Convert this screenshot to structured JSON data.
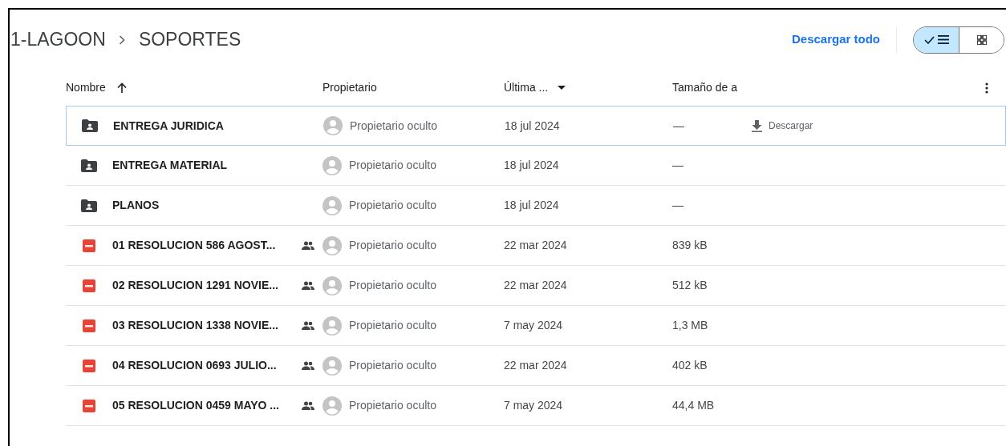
{
  "breadcrumb": [
    {
      "label": "1-LAGOON"
    },
    {
      "label": "SOPORTES"
    }
  ],
  "download_all": "Descargar todo",
  "view_toggle": [
    {
      "kind": "list",
      "selected": true
    },
    {
      "kind": "grid",
      "selected": false
    }
  ],
  "columns": [
    {
      "label": "Nombre",
      "kind": "sorted"
    },
    {
      "label": "Propietario",
      "kind": "plain"
    },
    {
      "label": "Última ...",
      "kind": "dropdown"
    },
    {
      "label": "Tamaño de a",
      "kind": "plain"
    }
  ],
  "rows": [
    {
      "kind": "folder",
      "name": "ENTREGA JURIDICA",
      "shared": false,
      "owner": "Propietario oculto",
      "modified": "18 jul 2024",
      "size": "—",
      "selected": true,
      "action": "Descargar"
    },
    {
      "kind": "folder",
      "name": "ENTREGA MATERIAL",
      "shared": false,
      "owner": "Propietario oculto",
      "modified": "18 jul 2024",
      "size": "—",
      "selected": false
    },
    {
      "kind": "folder",
      "name": "PLANOS",
      "shared": false,
      "owner": "Propietario oculto",
      "modified": "18 jul 2024",
      "size": "—",
      "selected": false
    },
    {
      "kind": "pdf",
      "name": "01 RESOLUCION 586 AGOST...",
      "shared": true,
      "owner": "Propietario oculto",
      "modified": "22 mar 2024",
      "size": "839 kB",
      "selected": false
    },
    {
      "kind": "pdf",
      "name": "02 RESOLUCION 1291 NOVIE...",
      "shared": true,
      "owner": "Propietario oculto",
      "modified": "22 mar 2024",
      "size": "512 kB",
      "selected": false
    },
    {
      "kind": "pdf",
      "name": "03 RESOLUCION 1338 NOVIE...",
      "shared": true,
      "owner": "Propietario oculto",
      "modified": "7 may 2024",
      "size": "1,3 MB",
      "selected": false
    },
    {
      "kind": "pdf",
      "name": "04 RESOLUCION 0693 JULIO...",
      "shared": true,
      "owner": "Propietario oculto",
      "modified": "22 mar 2024",
      "size": "402 kB",
      "selected": false
    },
    {
      "kind": "pdf",
      "name": "05 RESOLUCION 0459 MAYO ...",
      "shared": true,
      "owner": "Propietario oculto",
      "modified": "7 may 2024",
      "size": "44,4 MB",
      "selected": false
    }
  ]
}
